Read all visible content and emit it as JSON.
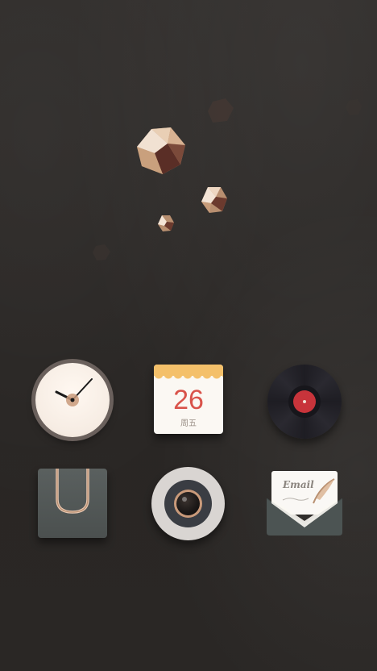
{
  "wallpaper": {
    "theme": "dark bronze gems"
  },
  "home_screen": {
    "icons": [
      {
        "id": "clock",
        "icon": "clock-icon"
      },
      {
        "id": "calendar",
        "icon": "calendar-icon",
        "day": "26",
        "weekday": "周五"
      },
      {
        "id": "music",
        "icon": "vinyl-record-icon"
      },
      {
        "id": "files",
        "icon": "paperclip-folder-icon"
      },
      {
        "id": "camera",
        "icon": "camera-lens-icon"
      },
      {
        "id": "email",
        "icon": "email-envelope-icon",
        "text": "Email"
      }
    ]
  },
  "colors": {
    "background": "#2b2826",
    "calendar_accent": "#f4c06a",
    "calendar_text": "#d9534a",
    "record_label": "#c8343b"
  }
}
